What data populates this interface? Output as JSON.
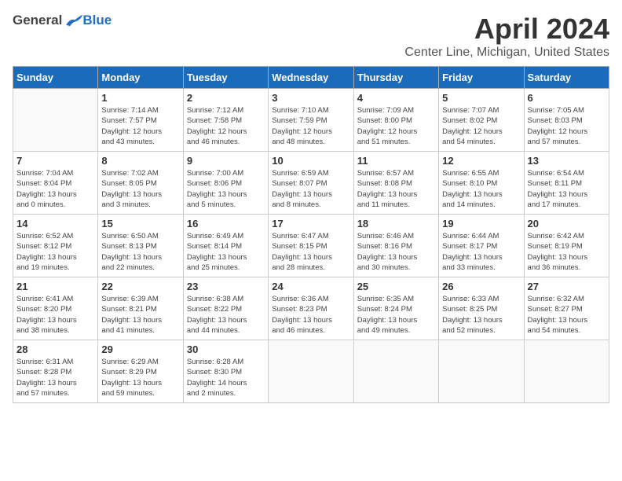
{
  "header": {
    "logo_general": "General",
    "logo_blue": "Blue",
    "month_year": "April 2024",
    "location": "Center Line, Michigan, United States"
  },
  "weekdays": [
    "Sunday",
    "Monday",
    "Tuesday",
    "Wednesday",
    "Thursday",
    "Friday",
    "Saturday"
  ],
  "weeks": [
    [
      {
        "day": "",
        "info": ""
      },
      {
        "day": "1",
        "info": "Sunrise: 7:14 AM\nSunset: 7:57 PM\nDaylight: 12 hours\nand 43 minutes."
      },
      {
        "day": "2",
        "info": "Sunrise: 7:12 AM\nSunset: 7:58 PM\nDaylight: 12 hours\nand 46 minutes."
      },
      {
        "day": "3",
        "info": "Sunrise: 7:10 AM\nSunset: 7:59 PM\nDaylight: 12 hours\nand 48 minutes."
      },
      {
        "day": "4",
        "info": "Sunrise: 7:09 AM\nSunset: 8:00 PM\nDaylight: 12 hours\nand 51 minutes."
      },
      {
        "day": "5",
        "info": "Sunrise: 7:07 AM\nSunset: 8:02 PM\nDaylight: 12 hours\nand 54 minutes."
      },
      {
        "day": "6",
        "info": "Sunrise: 7:05 AM\nSunset: 8:03 PM\nDaylight: 12 hours\nand 57 minutes."
      }
    ],
    [
      {
        "day": "7",
        "info": "Sunrise: 7:04 AM\nSunset: 8:04 PM\nDaylight: 13 hours\nand 0 minutes."
      },
      {
        "day": "8",
        "info": "Sunrise: 7:02 AM\nSunset: 8:05 PM\nDaylight: 13 hours\nand 3 minutes."
      },
      {
        "day": "9",
        "info": "Sunrise: 7:00 AM\nSunset: 8:06 PM\nDaylight: 13 hours\nand 5 minutes."
      },
      {
        "day": "10",
        "info": "Sunrise: 6:59 AM\nSunset: 8:07 PM\nDaylight: 13 hours\nand 8 minutes."
      },
      {
        "day": "11",
        "info": "Sunrise: 6:57 AM\nSunset: 8:08 PM\nDaylight: 13 hours\nand 11 minutes."
      },
      {
        "day": "12",
        "info": "Sunrise: 6:55 AM\nSunset: 8:10 PM\nDaylight: 13 hours\nand 14 minutes."
      },
      {
        "day": "13",
        "info": "Sunrise: 6:54 AM\nSunset: 8:11 PM\nDaylight: 13 hours\nand 17 minutes."
      }
    ],
    [
      {
        "day": "14",
        "info": "Sunrise: 6:52 AM\nSunset: 8:12 PM\nDaylight: 13 hours\nand 19 minutes."
      },
      {
        "day": "15",
        "info": "Sunrise: 6:50 AM\nSunset: 8:13 PM\nDaylight: 13 hours\nand 22 minutes."
      },
      {
        "day": "16",
        "info": "Sunrise: 6:49 AM\nSunset: 8:14 PM\nDaylight: 13 hours\nand 25 minutes."
      },
      {
        "day": "17",
        "info": "Sunrise: 6:47 AM\nSunset: 8:15 PM\nDaylight: 13 hours\nand 28 minutes."
      },
      {
        "day": "18",
        "info": "Sunrise: 6:46 AM\nSunset: 8:16 PM\nDaylight: 13 hours\nand 30 minutes."
      },
      {
        "day": "19",
        "info": "Sunrise: 6:44 AM\nSunset: 8:17 PM\nDaylight: 13 hours\nand 33 minutes."
      },
      {
        "day": "20",
        "info": "Sunrise: 6:42 AM\nSunset: 8:19 PM\nDaylight: 13 hours\nand 36 minutes."
      }
    ],
    [
      {
        "day": "21",
        "info": "Sunrise: 6:41 AM\nSunset: 8:20 PM\nDaylight: 13 hours\nand 38 minutes."
      },
      {
        "day": "22",
        "info": "Sunrise: 6:39 AM\nSunset: 8:21 PM\nDaylight: 13 hours\nand 41 minutes."
      },
      {
        "day": "23",
        "info": "Sunrise: 6:38 AM\nSunset: 8:22 PM\nDaylight: 13 hours\nand 44 minutes."
      },
      {
        "day": "24",
        "info": "Sunrise: 6:36 AM\nSunset: 8:23 PM\nDaylight: 13 hours\nand 46 minutes."
      },
      {
        "day": "25",
        "info": "Sunrise: 6:35 AM\nSunset: 8:24 PM\nDaylight: 13 hours\nand 49 minutes."
      },
      {
        "day": "26",
        "info": "Sunrise: 6:33 AM\nSunset: 8:25 PM\nDaylight: 13 hours\nand 52 minutes."
      },
      {
        "day": "27",
        "info": "Sunrise: 6:32 AM\nSunset: 8:27 PM\nDaylight: 13 hours\nand 54 minutes."
      }
    ],
    [
      {
        "day": "28",
        "info": "Sunrise: 6:31 AM\nSunset: 8:28 PM\nDaylight: 13 hours\nand 57 minutes."
      },
      {
        "day": "29",
        "info": "Sunrise: 6:29 AM\nSunset: 8:29 PM\nDaylight: 13 hours\nand 59 minutes."
      },
      {
        "day": "30",
        "info": "Sunrise: 6:28 AM\nSunset: 8:30 PM\nDaylight: 14 hours\nand 2 minutes."
      },
      {
        "day": "",
        "info": ""
      },
      {
        "day": "",
        "info": ""
      },
      {
        "day": "",
        "info": ""
      },
      {
        "day": "",
        "info": ""
      }
    ]
  ]
}
